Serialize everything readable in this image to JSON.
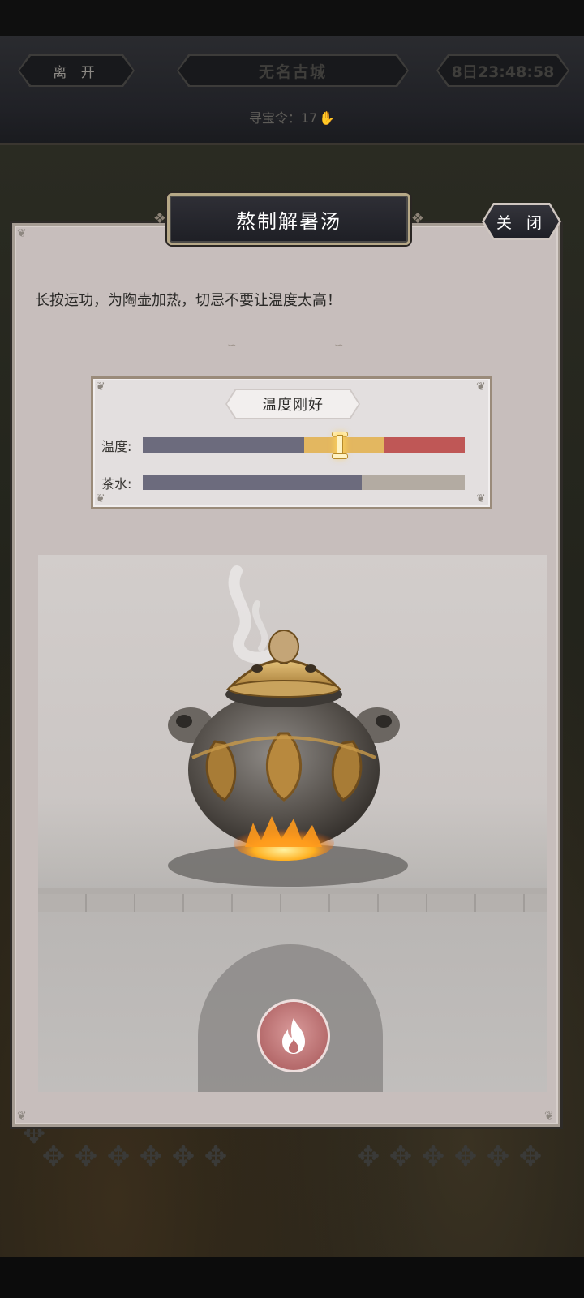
{
  "header": {
    "leave_label": "离 开",
    "location": "无名古城",
    "timer": "8日23:48:58",
    "token_text": "寻宝令：17"
  },
  "dialog": {
    "title": "熬制解暑汤",
    "close_label": "关 闭",
    "instruction": "长按运功，为陶壶加热，切忌不要让温度太高！",
    "status": "温度刚好",
    "temperature_label": "温度:",
    "tea_label": "茶水:",
    "temperature_level": 0.61,
    "tea_level": 0.68,
    "temperature_zones": [
      {
        "zone": "cool",
        "fraction": 0.5,
        "color": "#6c6b7d"
      },
      {
        "zone": "good",
        "fraction": 0.25,
        "color": "#e3b760"
      },
      {
        "zone": "hot",
        "fraction": 0.25,
        "color": "#bf5756"
      }
    ],
    "tea_fill_color": "#6c6b7d",
    "tea_empty_color": "#b3aba2"
  },
  "icons": {
    "fire": "fire-icon",
    "hand": "hand-icon"
  }
}
